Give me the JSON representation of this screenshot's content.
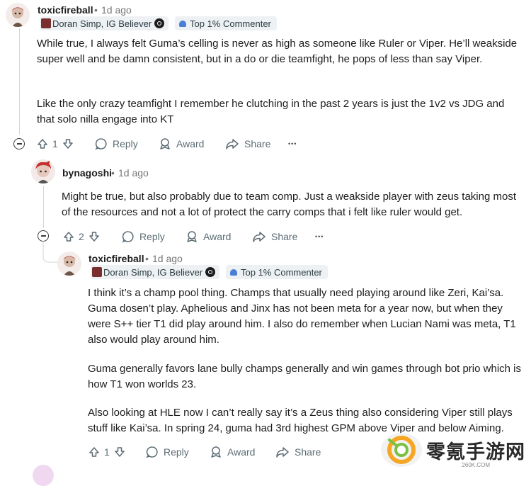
{
  "comments": [
    {
      "username": "toxicfireball",
      "dot": "•",
      "time": "1d ago",
      "flair": "Doran Simp, IG Believer",
      "badge": "Top 1% Commenter",
      "paragraphs": [
        "While true, I always felt Guma’s celling is never as high as someone like Ruler or Viper. He’ll weakside super well and be damn consistent, but in a do or die teamfight, he pops of less than say Viper.",
        "Like the only crazy teamfight I remember he clutching in the past 2 years is just the 1v2 vs JDG and that solo nilla engage into KT"
      ],
      "votes": "1",
      "reply": "Reply",
      "award": "Award",
      "share": "Share",
      "more": "•••"
    },
    {
      "username": "bynagoshi",
      "dot": "•",
      "time": "1d ago",
      "paragraphs": [
        "Might be true, but also probably due to team comp. Just a weakside player with zeus taking most of the resources and not a lot of protect the carry comps that i felt like ruler would get."
      ],
      "votes": "2",
      "reply": "Reply",
      "award": "Award",
      "share": "Share",
      "more": "•••"
    },
    {
      "username": "toxicfireball",
      "dot": "•",
      "time": "1d ago",
      "flair": "Doran Simp, IG Believer",
      "badge": "Top 1% Commenter",
      "paragraphs": [
        "I think it’s a champ pool thing. Champs that usually need playing around like Zeri, Kai’sa. Guma dosen’t play. Aphelious and Jinx has not been meta for a year now, but when they were S++ tier T1 did play around him. I also do remember when Lucian Nami was meta, T1 also would play around him.",
        "Guma generally favors lane bully champs generally and win games through bot prio which is how T1 won worlds 23.",
        "Also looking at HLE now I can’t really say it’s a Zeus thing also considering Viper still plays stuff like Kai’sa. In spring 24, guma had 3rd highest GPM above Viper and below Aiming."
      ],
      "votes": "1",
      "reply": "Reply",
      "award": "Award",
      "share": "Share"
    }
  ],
  "watermark": {
    "text": "零氪手游网",
    "sub": "260K.COM"
  },
  "colors": {
    "muted": "#767676",
    "action": "#5c6c74",
    "badge_bg": "#eef1f3",
    "accent_blue": "#4a7fd6"
  }
}
